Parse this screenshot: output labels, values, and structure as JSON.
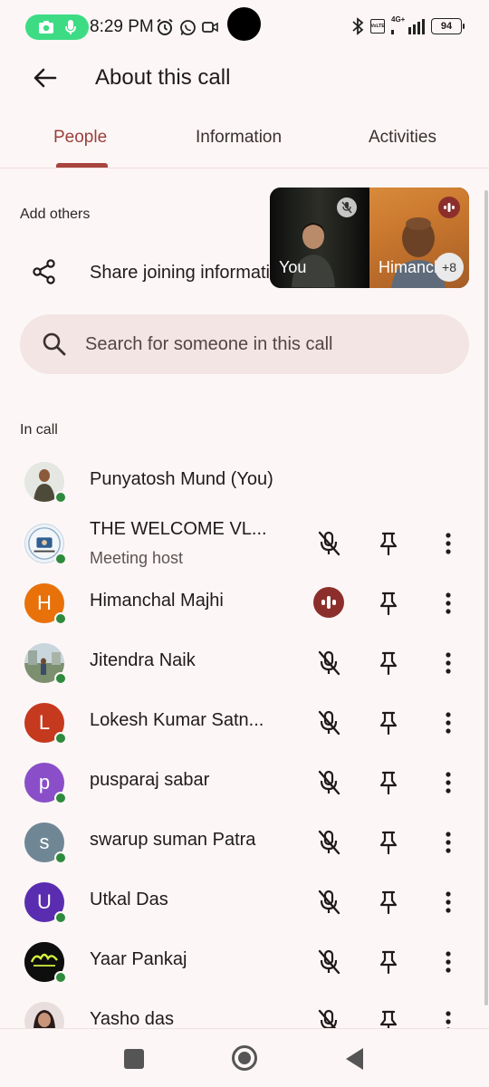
{
  "status_bar": {
    "time": "8:29 PM",
    "network_label_top": "4G+",
    "network_label_bottom": "VoLTE",
    "battery": "94"
  },
  "header": {
    "title": "About this call",
    "back_icon": "arrow-back-icon"
  },
  "tabs": [
    {
      "label": "People",
      "active": true
    },
    {
      "label": "Information",
      "active": false
    },
    {
      "label": "Activities",
      "active": false
    }
  ],
  "add_others": {
    "heading": "Add others",
    "share_label": "Share joining information",
    "share_icon": "share-icon"
  },
  "video_tiles": [
    {
      "name": "You",
      "muted": true
    },
    {
      "name": "Himanchal",
      "speaking": true,
      "more_count": "+8"
    }
  ],
  "search": {
    "placeholder": "Search for someone in this call"
  },
  "in_call": {
    "heading": "In call",
    "participants": [
      {
        "name": "Punyatosh Mund (You)",
        "subtitle": "",
        "avatar_type": "photo",
        "avatar_color": "#6b7b5a",
        "initial": "",
        "mic": "none"
      },
      {
        "name": "THE WELCOME VL...",
        "subtitle": "Meeting host",
        "avatar_type": "photo",
        "avatar_color": "#3a6fa8",
        "initial": "",
        "mic": "muted"
      },
      {
        "name": "Himanchal Majhi",
        "subtitle": "",
        "avatar_type": "initial",
        "avatar_color": "#e8710a",
        "initial": "H",
        "mic": "speaking"
      },
      {
        "name": "Jitendra Naik",
        "subtitle": "",
        "avatar_type": "photo",
        "avatar_color": "#7a8a96",
        "initial": "",
        "mic": "muted"
      },
      {
        "name": "Lokesh Kumar Satn...",
        "subtitle": "",
        "avatar_type": "initial",
        "avatar_color": "#c5391e",
        "initial": "L",
        "mic": "muted"
      },
      {
        "name": "pusparaj sabar",
        "subtitle": "",
        "avatar_type": "initial",
        "avatar_color": "#8a4fc8",
        "initial": "p",
        "mic": "muted"
      },
      {
        "name": "swarup suman Patra",
        "subtitle": "",
        "avatar_type": "initial",
        "avatar_color": "#6f8795",
        "initial": "s",
        "mic": "muted"
      },
      {
        "name": "Utkal Das",
        "subtitle": "",
        "avatar_type": "initial",
        "avatar_color": "#5a2db0",
        "initial": "U",
        "mic": "muted"
      },
      {
        "name": "Yaar Pankaj",
        "subtitle": "",
        "avatar_type": "photo",
        "avatar_color": "#111111",
        "initial": "",
        "mic": "muted"
      },
      {
        "name": "Yasho das",
        "subtitle": "",
        "avatar_type": "photo",
        "avatar_color": "#3a2a2a",
        "initial": "",
        "mic": "muted"
      }
    ]
  },
  "colors": {
    "accent": "#9a3f3a",
    "speaking": "#8c2f2c",
    "online": "#2e8b3d",
    "background": "#fcf7f6",
    "search_bg": "#f2e5e3"
  }
}
